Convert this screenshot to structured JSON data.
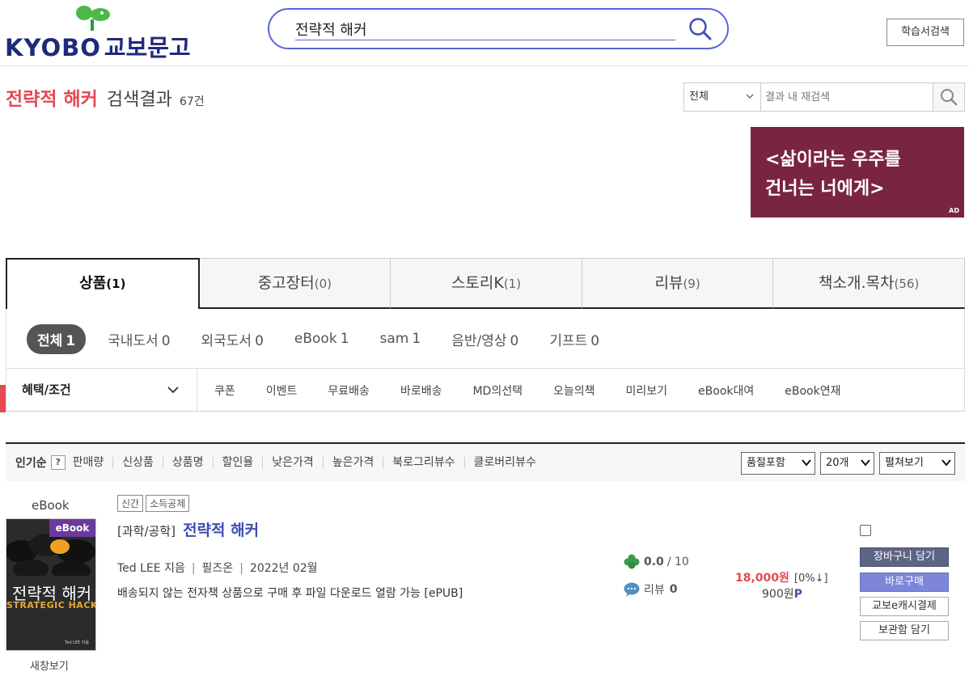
{
  "header": {
    "logo_text": "KYOBO",
    "logo_text_ko": "교보문고",
    "search_value": "전략적 해커",
    "study_search_label": "학습서검색"
  },
  "result": {
    "keyword": "전략적 해커",
    "label": "검색결과",
    "count": "67건",
    "research": {
      "scope": "전체",
      "placeholder": "결과 내 재검색"
    }
  },
  "ad": {
    "line1": "<삶이라는 우주를",
    "line2": "건너는 너에게>",
    "mark": "AD",
    "colors": {
      "bg": "#7a2540"
    }
  },
  "tabs": [
    {
      "label": "상품",
      "count": "(1)"
    },
    {
      "label": "중고장터",
      "count": "(0)"
    },
    {
      "label": "스토리K",
      "count": "(1)"
    },
    {
      "label": "리뷰",
      "count": "(9)"
    },
    {
      "label": "책소개.목차",
      "count": "(56)"
    }
  ],
  "categories": [
    {
      "label": "전체",
      "count": "1"
    },
    {
      "label": "국내도서",
      "count": "0"
    },
    {
      "label": "외국도서",
      "count": "0"
    },
    {
      "label": "eBook",
      "count": "1"
    },
    {
      "label": "sam",
      "count": "1"
    },
    {
      "label": "음반/영상",
      "count": "0"
    },
    {
      "label": "기프트",
      "count": "0"
    }
  ],
  "filters": {
    "benefit_label": "혜택/조건",
    "options": [
      "쿠폰",
      "이벤트",
      "무료배송",
      "바로배송",
      "MD의선택",
      "오늘의책",
      "미리보기",
      "eBook대여",
      "eBook연재"
    ]
  },
  "sort": {
    "primary": "인기순",
    "help": "?",
    "items": [
      "판매량",
      "신상품",
      "상품명",
      "할인율",
      "낮은가격",
      "높은가격",
      "북로그리뷰수",
      "클로버리뷰수"
    ],
    "selects": [
      "품절포함",
      "20개",
      "펼쳐보기"
    ]
  },
  "product": {
    "type": "eBook",
    "cover": {
      "badge": "eBook",
      "title_ko": "전략적 해커",
      "title_en": "STRATEGIC HACKER",
      "author_small": "Ted LEE 지음"
    },
    "new_view": "새창보기",
    "tags": [
      "신간",
      "소득공제"
    ],
    "category": "[과학/공학]",
    "title": "전략적 해커",
    "author": "Ted LEE 지음",
    "publisher": "필즈온",
    "date": "2022년 02월",
    "description": "배송되지 않는 전자책 상품으로 구매 후 파일 다운로드 열람 가능 [ePUB]",
    "rating": "0.0",
    "rating_max": "/ 10",
    "review_label": "리뷰",
    "review_count": "0",
    "price": "18,000원",
    "discount": "[0%↓]",
    "points": "900원",
    "points_mark": "P",
    "buttons": {
      "cart": "장바구니 담기",
      "buy": "바로구매",
      "cash": "교보e캐시결제",
      "keep": "보관함 담기"
    }
  },
  "colors": {
    "brand_navy": "#1e2b7a",
    "accent_red": "#e54a53",
    "link_blue": "#3e4db8",
    "search_border": "#5965d6"
  }
}
